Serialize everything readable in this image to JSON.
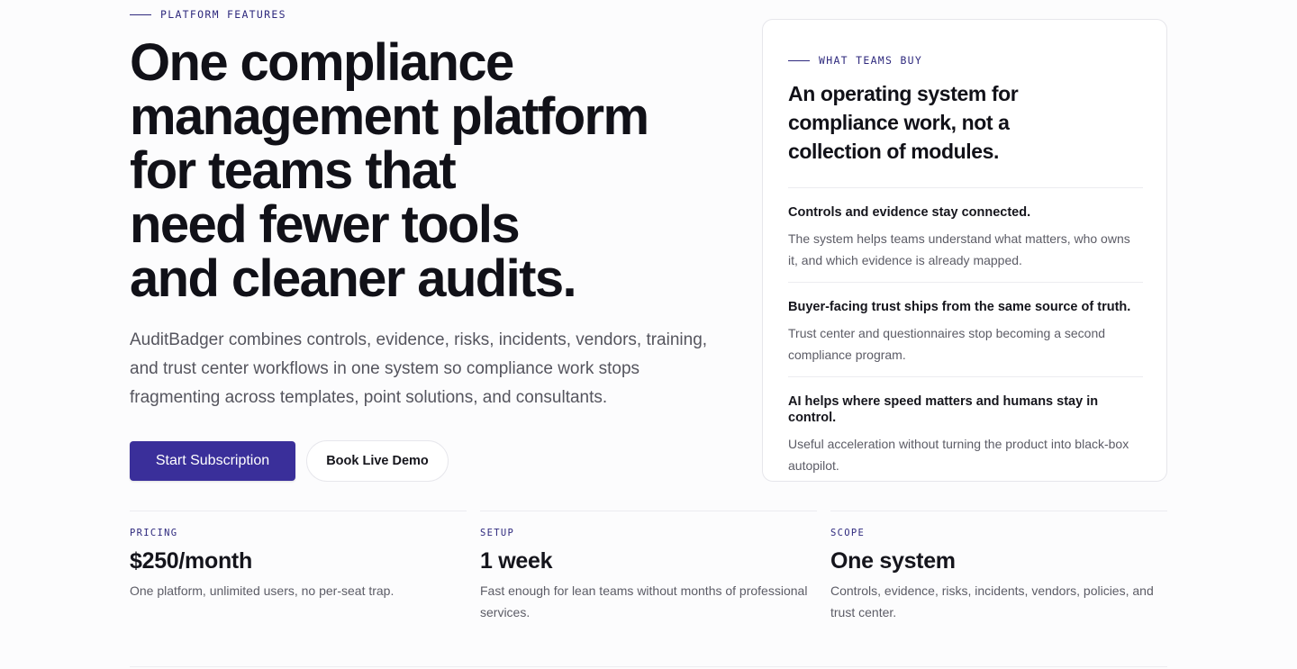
{
  "hero": {
    "eyebrow": "PLATFORM FEATURES",
    "title_lines": [
      "One compliance",
      "management platform",
      "for teams that",
      "need fewer tools",
      "and cleaner audits."
    ],
    "lede": "AuditBadger combines controls, evidence, risks, incidents, vendors, training, and trust center workflows in one system so compliance work stops fragmenting across templates, point solutions, and consultants.",
    "primary_button": "Start Subscription",
    "secondary_button": "Book Live Demo"
  },
  "card": {
    "eyebrow": "WHAT TEAMS BUY",
    "title": "An operating system for compliance work, not a collection of modules.",
    "items": [
      {
        "title": "Controls and evidence stay connected.",
        "text": "The system helps teams understand what matters, who owns it, and which evidence is already mapped."
      },
      {
        "title": "Buyer-facing trust ships from the same source of truth.",
        "text": "Trust center and questionnaires stop becoming a second compliance program."
      },
      {
        "title": "AI helps where speed matters and humans stay in control.",
        "text": "Useful acceleration without turning the product into black-box autopilot."
      }
    ]
  },
  "stats": [
    {
      "label": "PRICING",
      "value": "$250/month",
      "text": "One platform, unlimited users, no per-seat trap."
    },
    {
      "label": "SETUP",
      "value": "1 week",
      "text": "Fast enough for lean teams without months of professional services."
    },
    {
      "label": "SCOPE",
      "value": "One system",
      "text": "Controls, evidence, risks, incidents, vendors, policies, and trust center."
    }
  ],
  "colors": {
    "accent": "#3a2f9a",
    "eyebrow": "#2f2a7e",
    "heading": "#111118",
    "body": "#55555e"
  }
}
